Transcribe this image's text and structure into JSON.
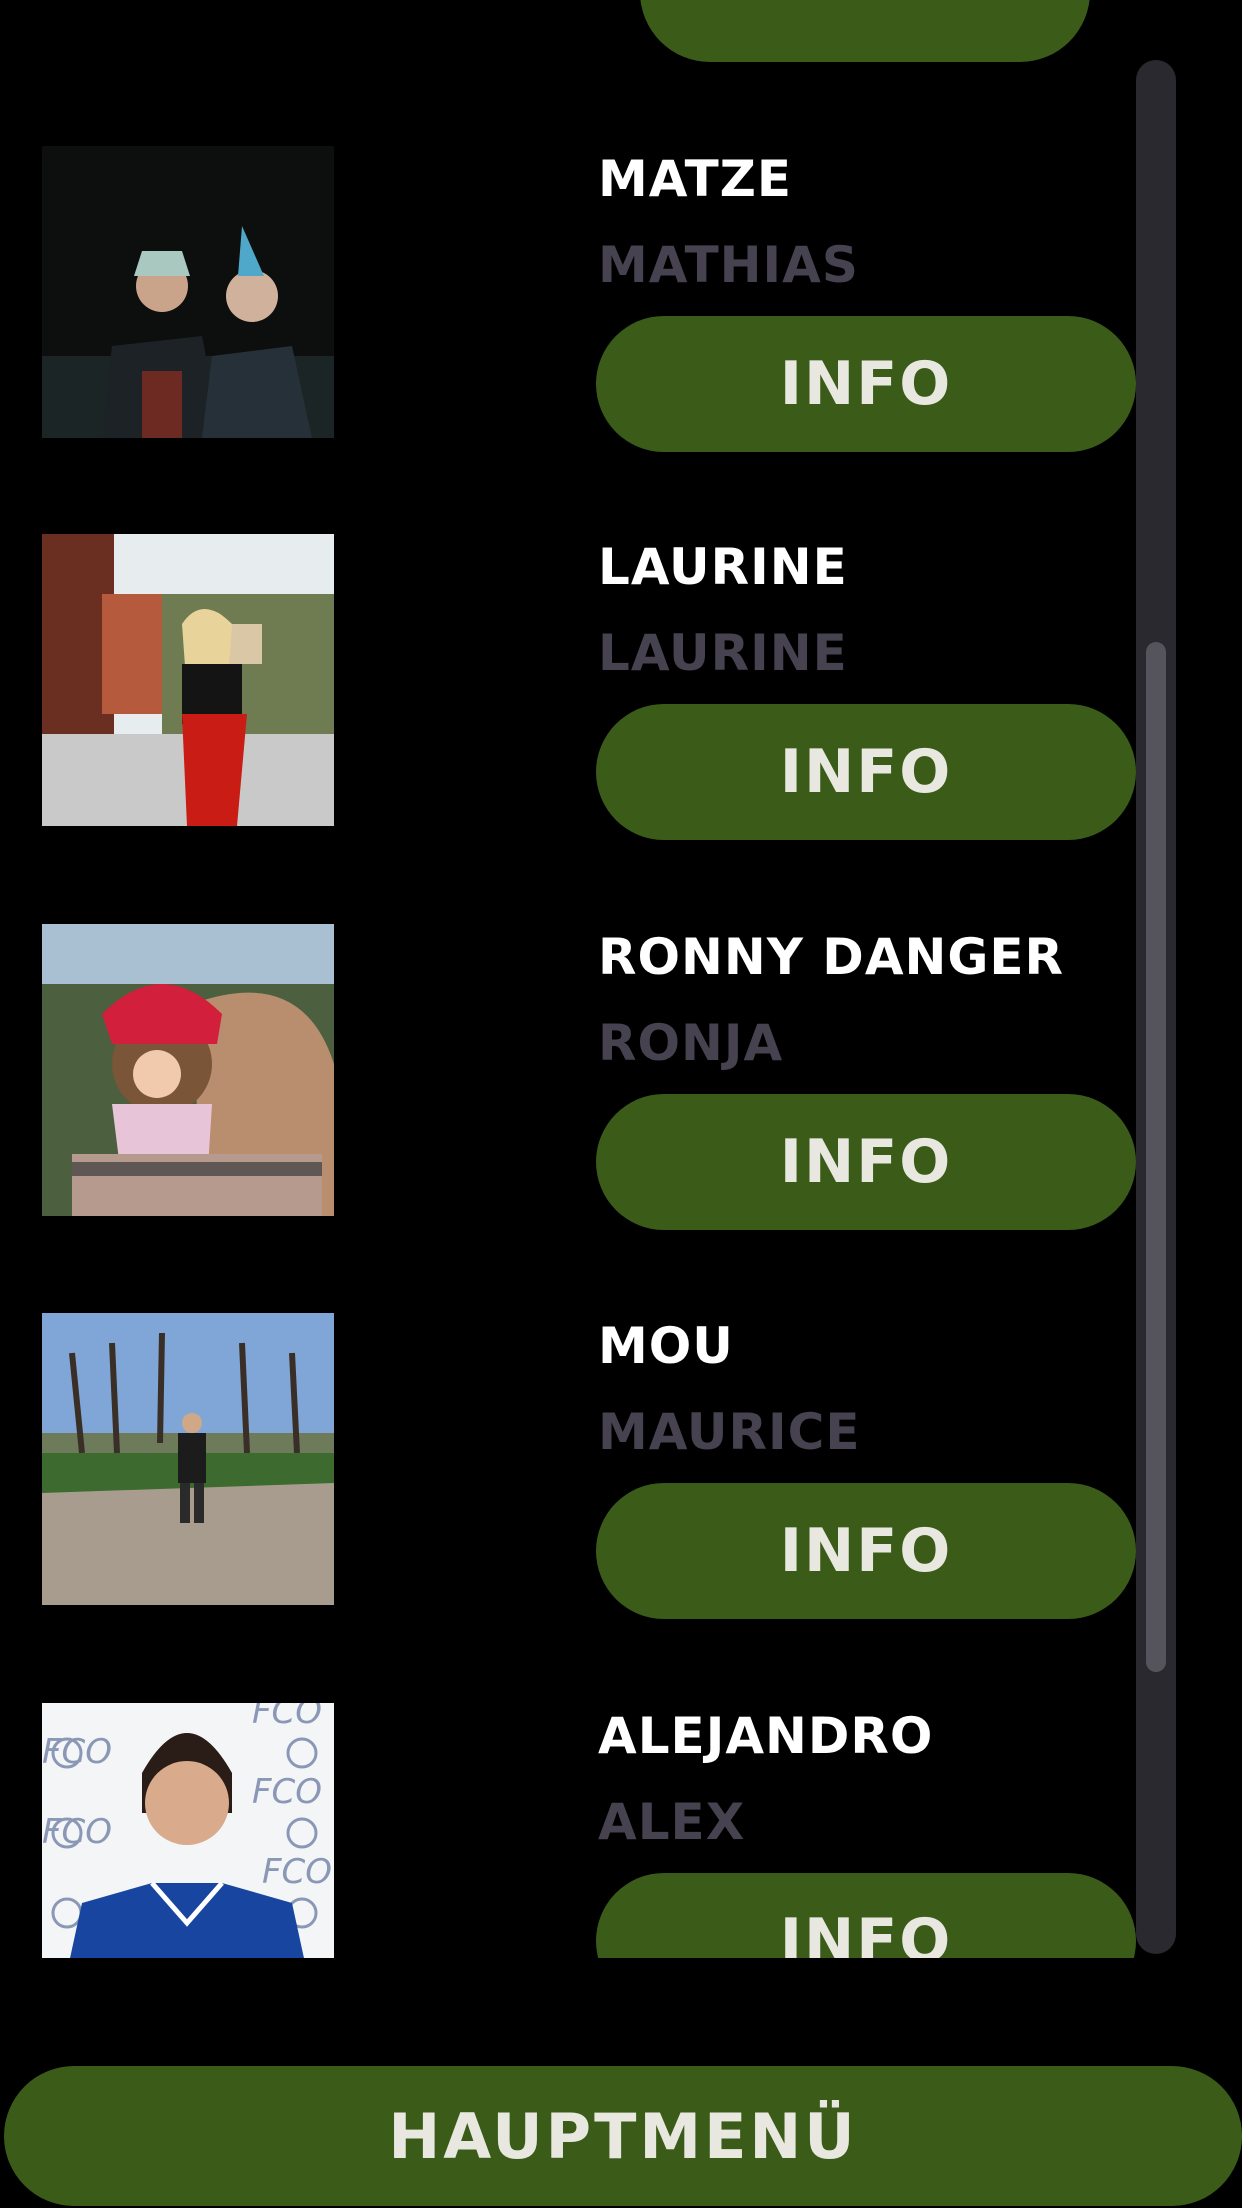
{
  "players": [
    {
      "nickname": "MATZE",
      "realname": "MATHIAS",
      "info_label": "INFO"
    },
    {
      "nickname": "LAURINE",
      "realname": "LAURINE",
      "info_label": "INFO"
    },
    {
      "nickname": "RONNY DANGER",
      "realname": "RONJA",
      "info_label": "INFO"
    },
    {
      "nickname": "MOU",
      "realname": "MAURICE",
      "info_label": "INFO"
    },
    {
      "nickname": "ALEJANDRO",
      "realname": "ALEX",
      "info_label": "INFO"
    }
  ],
  "main_menu_label": "HAUPTMENÜ",
  "colors": {
    "background": "#000000",
    "button_green": "#3a5c18",
    "button_text": "#e8e8e0",
    "nickname_text": "#ffffff",
    "realname_text": "#46424f",
    "scroll_track": "#2a292f",
    "scroll_thumb": "#55535c"
  }
}
